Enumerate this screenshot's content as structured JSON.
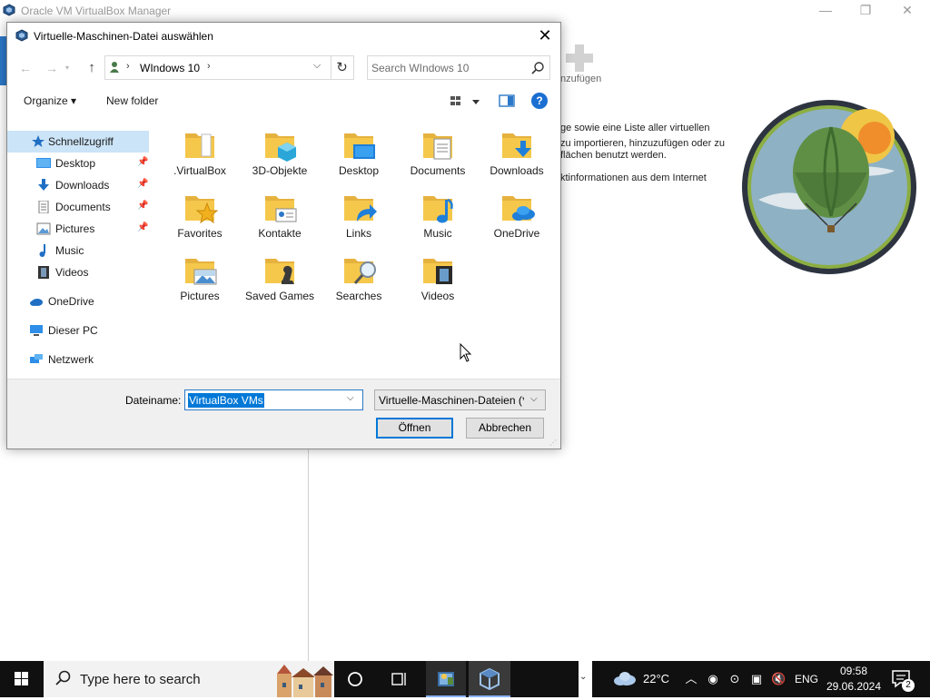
{
  "vbox": {
    "title": "Oracle VM VirtualBox Manager",
    "add_label": "nzufügen",
    "welcome_lines": [
      "ge sowie eine Liste aller virtuellen",
      "zu importieren, hinzuzufügen oder zu",
      "flächen benutzt werden.",
      "ktinformationen aus dem Internet"
    ],
    "minimize": "—",
    "restore": "❐",
    "close": "✕"
  },
  "dialog": {
    "title": "Virtuelle-Maschinen-Datei auswählen",
    "close": "✕",
    "address": {
      "crumb": "WIndows 10"
    },
    "search": {
      "placeholder": "Search WIndows 10"
    },
    "toolbar": {
      "organize": "Organize ▾",
      "new_folder": "New folder",
      "help": "?"
    },
    "nav": {
      "quick_access": "Schnellzugriff",
      "items": [
        "Desktop",
        "Downloads",
        "Documents",
        "Pictures",
        "Music",
        "Videos"
      ],
      "onedrive": "OneDrive",
      "this_pc": "Dieser PC",
      "network": "Netzwerk"
    },
    "files": [
      ".VirtualBox",
      "3D-Objekte",
      "Desktop",
      "Documents",
      "Downloads",
      "Favorites",
      "Kontakte",
      "Links",
      "Music",
      "OneDrive",
      "Pictures",
      "Saved Games",
      "Searches",
      "Videos"
    ],
    "filename_label": "Dateiname:",
    "filename_value": "VirtualBox VMs",
    "filetype_value": "Virtuelle-Maschinen-Dateien (*",
    "open_button": "Öffnen",
    "cancel_button": "Abbrechen"
  },
  "taskbar": {
    "search_text": "Type here to search",
    "temperature": "22°C",
    "language": "ENG",
    "time": "09:58",
    "date": "29.06.2024",
    "notification_count": "2"
  },
  "colors": {
    "accent": "#0078d7",
    "selection": "#cce4f7",
    "folder": "#f5c84c",
    "taskbar": "#101010"
  }
}
